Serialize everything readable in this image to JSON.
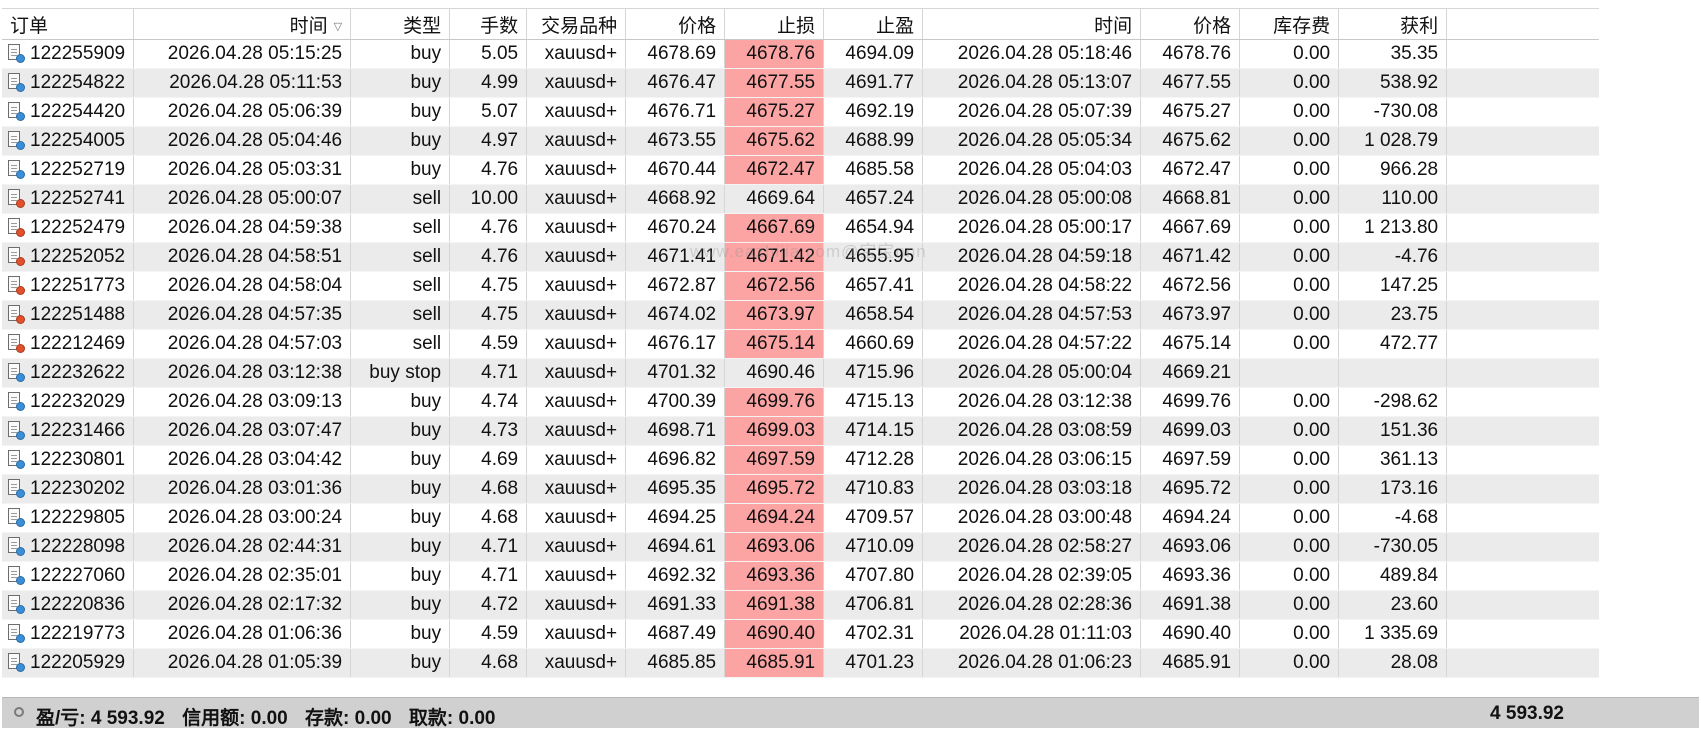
{
  "columns": {
    "order": "订单",
    "open_time": "时间",
    "type": "类型",
    "volume": "手数",
    "symbol": "交易品种",
    "open_price": "价格",
    "sl": "止损",
    "tp": "止盈",
    "close_time": "时间",
    "close_price": "价格",
    "swap": "库存费",
    "profit": "获利"
  },
  "rows": [
    {
      "order": "122255909",
      "open_time": "2026.04.28 05:15:25",
      "type": "buy",
      "volume": "5.05",
      "symbol": "xauusd+",
      "open_price": "4678.69",
      "sl": "4678.76",
      "tp": "4694.09",
      "close_time": "2026.04.28 05:18:46",
      "close_price": "4678.76",
      "swap": "0.00",
      "profit": "35.35",
      "sl_hit": true,
      "status_color": "#3b8fd9"
    },
    {
      "order": "122254822",
      "open_time": "2026.04.28 05:11:53",
      "type": "buy",
      "volume": "4.99",
      "symbol": "xauusd+",
      "open_price": "4676.47",
      "sl": "4677.55",
      "tp": "4691.77",
      "close_time": "2026.04.28 05:13:07",
      "close_price": "4677.55",
      "swap": "0.00",
      "profit": "538.92",
      "sl_hit": true,
      "status_color": "#3b8fd9"
    },
    {
      "order": "122254420",
      "open_time": "2026.04.28 05:06:39",
      "type": "buy",
      "volume": "5.07",
      "symbol": "xauusd+",
      "open_price": "4676.71",
      "sl": "4675.27",
      "tp": "4692.19",
      "close_time": "2026.04.28 05:07:39",
      "close_price": "4675.27",
      "swap": "0.00",
      "profit": "-730.08",
      "sl_hit": true,
      "status_color": "#3b8fd9"
    },
    {
      "order": "122254005",
      "open_time": "2026.04.28 05:04:46",
      "type": "buy",
      "volume": "4.97",
      "symbol": "xauusd+",
      "open_price": "4673.55",
      "sl": "4675.62",
      "tp": "4688.99",
      "close_time": "2026.04.28 05:05:34",
      "close_price": "4675.62",
      "swap": "0.00",
      "profit": "1 028.79",
      "sl_hit": true,
      "status_color": "#3b8fd9"
    },
    {
      "order": "122252719",
      "open_time": "2026.04.28 05:03:31",
      "type": "buy",
      "volume": "4.76",
      "symbol": "xauusd+",
      "open_price": "4670.44",
      "sl": "4672.47",
      "tp": "4685.58",
      "close_time": "2026.04.28 05:04:03",
      "close_price": "4672.47",
      "swap": "0.00",
      "profit": "966.28",
      "sl_hit": true,
      "status_color": "#3b8fd9"
    },
    {
      "order": "122252741",
      "open_time": "2026.04.28 05:00:07",
      "type": "sell",
      "volume": "10.00",
      "symbol": "xauusd+",
      "open_price": "4668.92",
      "sl": "4669.64",
      "tp": "4657.24",
      "close_time": "2026.04.28 05:00:08",
      "close_price": "4668.81",
      "swap": "0.00",
      "profit": "110.00",
      "sl_hit": false,
      "status_color": "#e2502c"
    },
    {
      "order": "122252479",
      "open_time": "2026.04.28 04:59:38",
      "type": "sell",
      "volume": "4.76",
      "symbol": "xauusd+",
      "open_price": "4670.24",
      "sl": "4667.69",
      "tp": "4654.94",
      "close_time": "2026.04.28 05:00:17",
      "close_price": "4667.69",
      "swap": "0.00",
      "profit": "1 213.80",
      "sl_hit": true,
      "status_color": "#e2502c"
    },
    {
      "order": "122252052",
      "open_time": "2026.04.28 04:58:51",
      "type": "sell",
      "volume": "4.76",
      "symbol": "xauusd+",
      "open_price": "4671.41",
      "sl": "4671.42",
      "tp": "4655.95",
      "close_time": "2026.04.28 04:59:18",
      "close_price": "4671.42",
      "swap": "0.00",
      "profit": "-4.76",
      "sl_hit": true,
      "status_color": "#e2502c"
    },
    {
      "order": "122251773",
      "open_time": "2026.04.28 04:58:04",
      "type": "sell",
      "volume": "4.75",
      "symbol": "xauusd+",
      "open_price": "4672.87",
      "sl": "4672.56",
      "tp": "4657.41",
      "close_time": "2026.04.28 04:58:22",
      "close_price": "4672.56",
      "swap": "0.00",
      "profit": "147.25",
      "sl_hit": true,
      "status_color": "#e2502c"
    },
    {
      "order": "122251488",
      "open_time": "2026.04.28 04:57:35",
      "type": "sell",
      "volume": "4.75",
      "symbol": "xauusd+",
      "open_price": "4674.02",
      "sl": "4673.97",
      "tp": "4658.54",
      "close_time": "2026.04.28 04:57:53",
      "close_price": "4673.97",
      "swap": "0.00",
      "profit": "23.75",
      "sl_hit": true,
      "status_color": "#e2502c"
    },
    {
      "order": "122212469",
      "open_time": "2026.04.28 04:57:03",
      "type": "sell",
      "volume": "4.59",
      "symbol": "xauusd+",
      "open_price": "4676.17",
      "sl": "4675.14",
      "tp": "4660.69",
      "close_time": "2026.04.28 04:57:22",
      "close_price": "4675.14",
      "swap": "0.00",
      "profit": "472.77",
      "sl_hit": true,
      "status_color": "#e2502c"
    },
    {
      "order": "122232622",
      "open_time": "2026.04.28 03:12:38",
      "type": "buy stop",
      "volume": "4.71",
      "symbol": "xauusd+",
      "open_price": "4701.32",
      "sl": "4690.46",
      "tp": "4715.96",
      "close_time": "2026.04.28 05:00:04",
      "close_price": "4669.21",
      "swap": "",
      "profit": "",
      "sl_hit": false,
      "status_color": "#3b8fd9"
    },
    {
      "order": "122232029",
      "open_time": "2026.04.28 03:09:13",
      "type": "buy",
      "volume": "4.74",
      "symbol": "xauusd+",
      "open_price": "4700.39",
      "sl": "4699.76",
      "tp": "4715.13",
      "close_time": "2026.04.28 03:12:38",
      "close_price": "4699.76",
      "swap": "0.00",
      "profit": "-298.62",
      "sl_hit": true,
      "status_color": "#3b8fd9"
    },
    {
      "order": "122231466",
      "open_time": "2026.04.28 03:07:47",
      "type": "buy",
      "volume": "4.73",
      "symbol": "xauusd+",
      "open_price": "4698.71",
      "sl": "4699.03",
      "tp": "4714.15",
      "close_time": "2026.04.28 03:08:59",
      "close_price": "4699.03",
      "swap": "0.00",
      "profit": "151.36",
      "sl_hit": true,
      "status_color": "#3b8fd9"
    },
    {
      "order": "122230801",
      "open_time": "2026.04.28 03:04:42",
      "type": "buy",
      "volume": "4.69",
      "symbol": "xauusd+",
      "open_price": "4696.82",
      "sl": "4697.59",
      "tp": "4712.28",
      "close_time": "2026.04.28 03:06:15",
      "close_price": "4697.59",
      "swap": "0.00",
      "profit": "361.13",
      "sl_hit": true,
      "status_color": "#3b8fd9"
    },
    {
      "order": "122230202",
      "open_time": "2026.04.28 03:01:36",
      "type": "buy",
      "volume": "4.68",
      "symbol": "xauusd+",
      "open_price": "4695.35",
      "sl": "4695.72",
      "tp": "4710.83",
      "close_time": "2026.04.28 03:03:18",
      "close_price": "4695.72",
      "swap": "0.00",
      "profit": "173.16",
      "sl_hit": true,
      "status_color": "#3b8fd9"
    },
    {
      "order": "122229805",
      "open_time": "2026.04.28 03:00:24",
      "type": "buy",
      "volume": "4.68",
      "symbol": "xauusd+",
      "open_price": "4694.25",
      "sl": "4694.24",
      "tp": "4709.57",
      "close_time": "2026.04.28 03:00:48",
      "close_price": "4694.24",
      "swap": "0.00",
      "profit": "-4.68",
      "sl_hit": true,
      "status_color": "#3b8fd9"
    },
    {
      "order": "122228098",
      "open_time": "2026.04.28 02:44:31",
      "type": "buy",
      "volume": "4.71",
      "symbol": "xauusd+",
      "open_price": "4694.61",
      "sl": "4693.06",
      "tp": "4710.09",
      "close_time": "2026.04.28 02:58:27",
      "close_price": "4693.06",
      "swap": "0.00",
      "profit": "-730.05",
      "sl_hit": true,
      "status_color": "#3b8fd9"
    },
    {
      "order": "122227060",
      "open_time": "2026.04.28 02:35:01",
      "type": "buy",
      "volume": "4.71",
      "symbol": "xauusd+",
      "open_price": "4692.32",
      "sl": "4693.36",
      "tp": "4707.80",
      "close_time": "2026.04.28 02:39:05",
      "close_price": "4693.36",
      "swap": "0.00",
      "profit": "489.84",
      "sl_hit": true,
      "status_color": "#3b8fd9"
    },
    {
      "order": "122220836",
      "open_time": "2026.04.28 02:17:32",
      "type": "buy",
      "volume": "4.72",
      "symbol": "xauusd+",
      "open_price": "4691.33",
      "sl": "4691.38",
      "tp": "4706.81",
      "close_time": "2026.04.28 02:28:36",
      "close_price": "4691.38",
      "swap": "0.00",
      "profit": "23.60",
      "sl_hit": true,
      "status_color": "#3b8fd9"
    },
    {
      "order": "122219773",
      "open_time": "2026.04.28 01:06:36",
      "type": "buy",
      "volume": "4.59",
      "symbol": "xauusd+",
      "open_price": "4687.49",
      "sl": "4690.40",
      "tp": "4702.31",
      "close_time": "2026.04.28 01:11:03",
      "close_price": "4690.40",
      "swap": "0.00",
      "profit": "1 335.69",
      "sl_hit": true,
      "status_color": "#3b8fd9"
    },
    {
      "order": "122205929",
      "open_time": "2026.04.28 01:05:39",
      "type": "buy",
      "volume": "4.68",
      "symbol": "xauusd+",
      "open_price": "4685.85",
      "sl": "4685.91",
      "tp": "4701.23",
      "close_time": "2026.04.28 01:06:23",
      "close_price": "4685.91",
      "swap": "0.00",
      "profit": "28.08",
      "sl_hit": true,
      "status_color": "#3b8fd9"
    }
  ],
  "summary": {
    "profit_loss": "盈/亏: 4 593.92",
    "credit": "信用额: 0.00",
    "deposit": "存款: 0.00",
    "withdrawal": "取款: 0.00",
    "total": "4 593.92"
  },
  "watermark": "www.eazhijia.com@宝宝nnn",
  "colors": {
    "sl_hit_bg": "#fca3a3",
    "row_alt_bg": "#ebebeb",
    "status_bar_bg": "#d0d0d0",
    "buy_dot": "#3b8fd9",
    "sell_dot": "#e2502c"
  }
}
